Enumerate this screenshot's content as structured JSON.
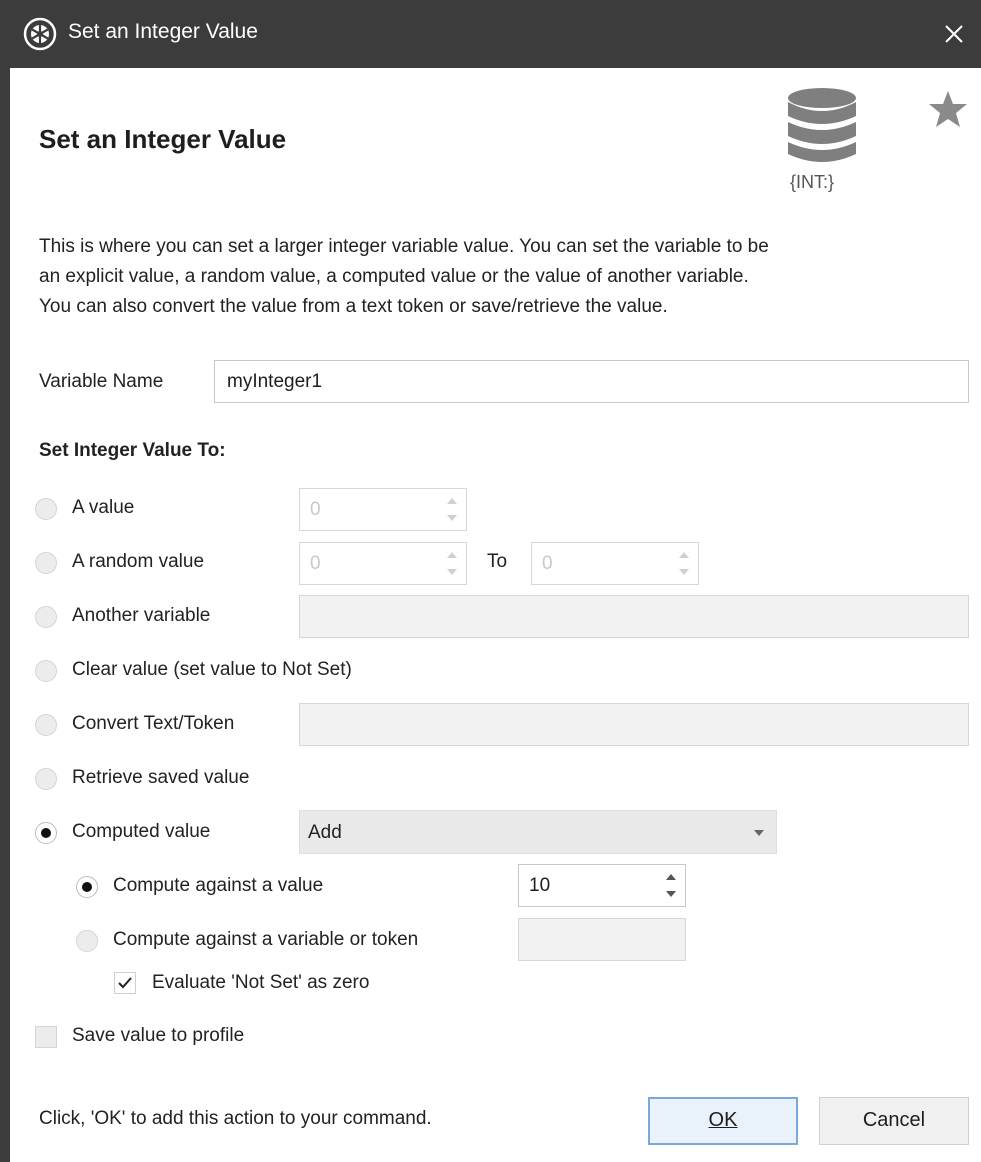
{
  "window": {
    "title": "Set an Integer Value",
    "close_icon": "close-icon",
    "app_icon": "voiceattack-logo-icon"
  },
  "header": {
    "heading": "Set an Integer Value",
    "db_icon_label": "{INT:}",
    "db_icon": "database-icon",
    "favorite_icon": "star-icon"
  },
  "description": {
    "line1": "This is where you can set a larger integer variable value.  You can set the variable to be",
    "line2": "an explicit value, a random value, a computed value or the value of another variable.",
    "line3": "You can also convert the value from a text token or save/retrieve the value."
  },
  "variable_name": {
    "label": "Variable Name",
    "value": "myInteger1"
  },
  "section_label": "Set Integer Value To:",
  "options": {
    "a_value": {
      "label": "A value",
      "spin_value": "0",
      "selected": false
    },
    "random": {
      "label": "A random value",
      "from": "0",
      "to_label": "To",
      "to": "0",
      "selected": false
    },
    "another_variable": {
      "label": "Another variable",
      "value": "",
      "selected": false
    },
    "clear": {
      "label": "Clear value (set value to Not Set)",
      "selected": false
    },
    "convert": {
      "label": "Convert Text/Token",
      "value": "",
      "selected": false
    },
    "retrieve": {
      "label": "Retrieve saved value",
      "selected": false
    },
    "computed": {
      "label": "Computed value",
      "operation": "Add",
      "selected": true
    }
  },
  "compute": {
    "against_value": {
      "label": "Compute against a value",
      "value": "10",
      "selected": true
    },
    "against_variable": {
      "label": "Compute against a variable or token",
      "value": "",
      "selected": false
    },
    "not_set_zero": {
      "label": "Evaluate 'Not Set' as zero",
      "checked": true
    }
  },
  "save_to_profile": {
    "label": "Save value to profile",
    "checked": false
  },
  "footer": {
    "hint": "Click, 'OK' to add this action to your command.",
    "ok": "OK",
    "cancel": "Cancel"
  },
  "colors": {
    "titlebar": "#3c3c3c",
    "default_button_border": "#7aa7dc",
    "disabled_field": "#f2f2f2"
  }
}
